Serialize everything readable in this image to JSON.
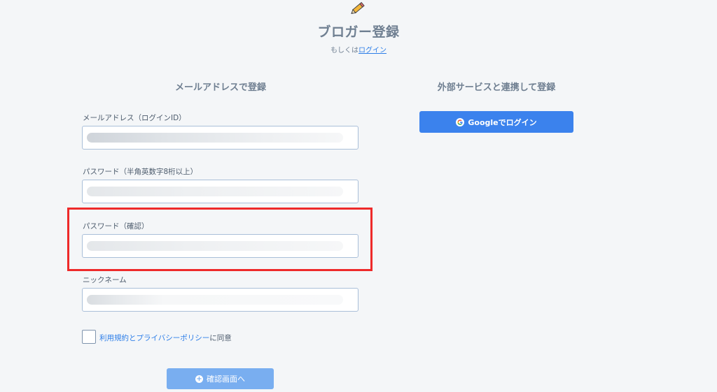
{
  "header": {
    "title": "ブロガー登録",
    "alt_prefix": "もしくは",
    "login_link": "ログイン"
  },
  "email_section": {
    "heading": "メールアドレスで登録",
    "fields": {
      "email_label": "メールアドレス（ログインID）",
      "password_label": "パスワード（半角英数字8桁以上）",
      "password_confirm_label": "パスワード（確認）",
      "nickname_label": "ニックネーム"
    },
    "agreement": {
      "link": "利用規約とプライバシーポリシー",
      "suffix": "に同意"
    },
    "confirm_button": "確認画面へ"
  },
  "external_section": {
    "heading": "外部サービスと連携して登録",
    "google_button": "Googleでログイン"
  },
  "icons": {
    "header": "pencil-icon",
    "confirm": "plus-circle-icon",
    "google": "google-icon"
  },
  "colors": {
    "background": "#f4f6f8",
    "link": "#2d7ee8",
    "google_button": "#3b82ed",
    "confirm_button": "#79aef0",
    "highlight": "#ee2a2a"
  }
}
